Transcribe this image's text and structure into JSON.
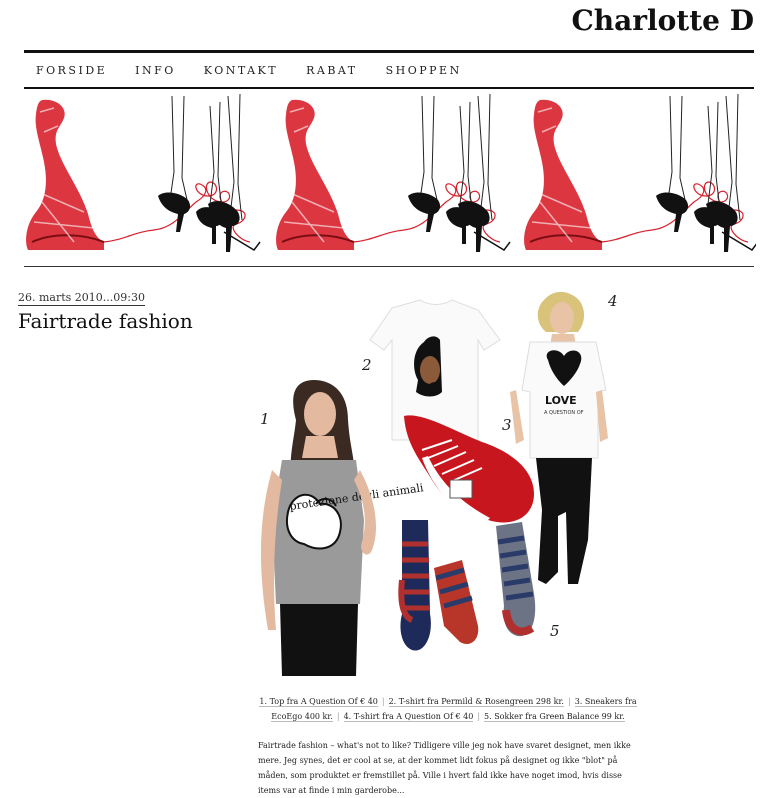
{
  "site": {
    "title": "Charlotte D"
  },
  "nav": {
    "items": [
      {
        "label": "FORSIDE"
      },
      {
        "label": "INFO"
      },
      {
        "label": "KONTAKT"
      },
      {
        "label": "RABAT"
      },
      {
        "label": "SHOPPEN"
      }
    ]
  },
  "post": {
    "date": "26. marts 2010...09:30",
    "title": "Fairtrade fashion",
    "collage_numbers": [
      "1",
      "2",
      "3",
      "4",
      "5"
    ],
    "shirt_text": {
      "love": "LOVE",
      "brand": "A QUESTION OF",
      "tank": "protezione degli animali"
    },
    "caption": [
      "1. Top fra A Question Of € 40",
      "2. T-shirt fra Permild & Rosengreen 298 kr.",
      "3. Sneakers fra EcoEgo 400 kr.",
      "4. T-shirt fra A Question Of € 40",
      "5. Sokker fra Green Balance 99 kr."
    ],
    "body": "Fairtrade fashion – what's not to like? Tidligere ville jeg nok have svaret designet, men ikke mere. Jeg synes, det er cool at se, at der kommet lidt fokus på designet og ikke \"blot\" på måden, som produktet er fremstillet på. Ville i hvert fald ikke have noget imod, hvis disse items var at finde i min garderobe..."
  },
  "colors": {
    "accent": "#d8202c",
    "ink": "#111111"
  }
}
